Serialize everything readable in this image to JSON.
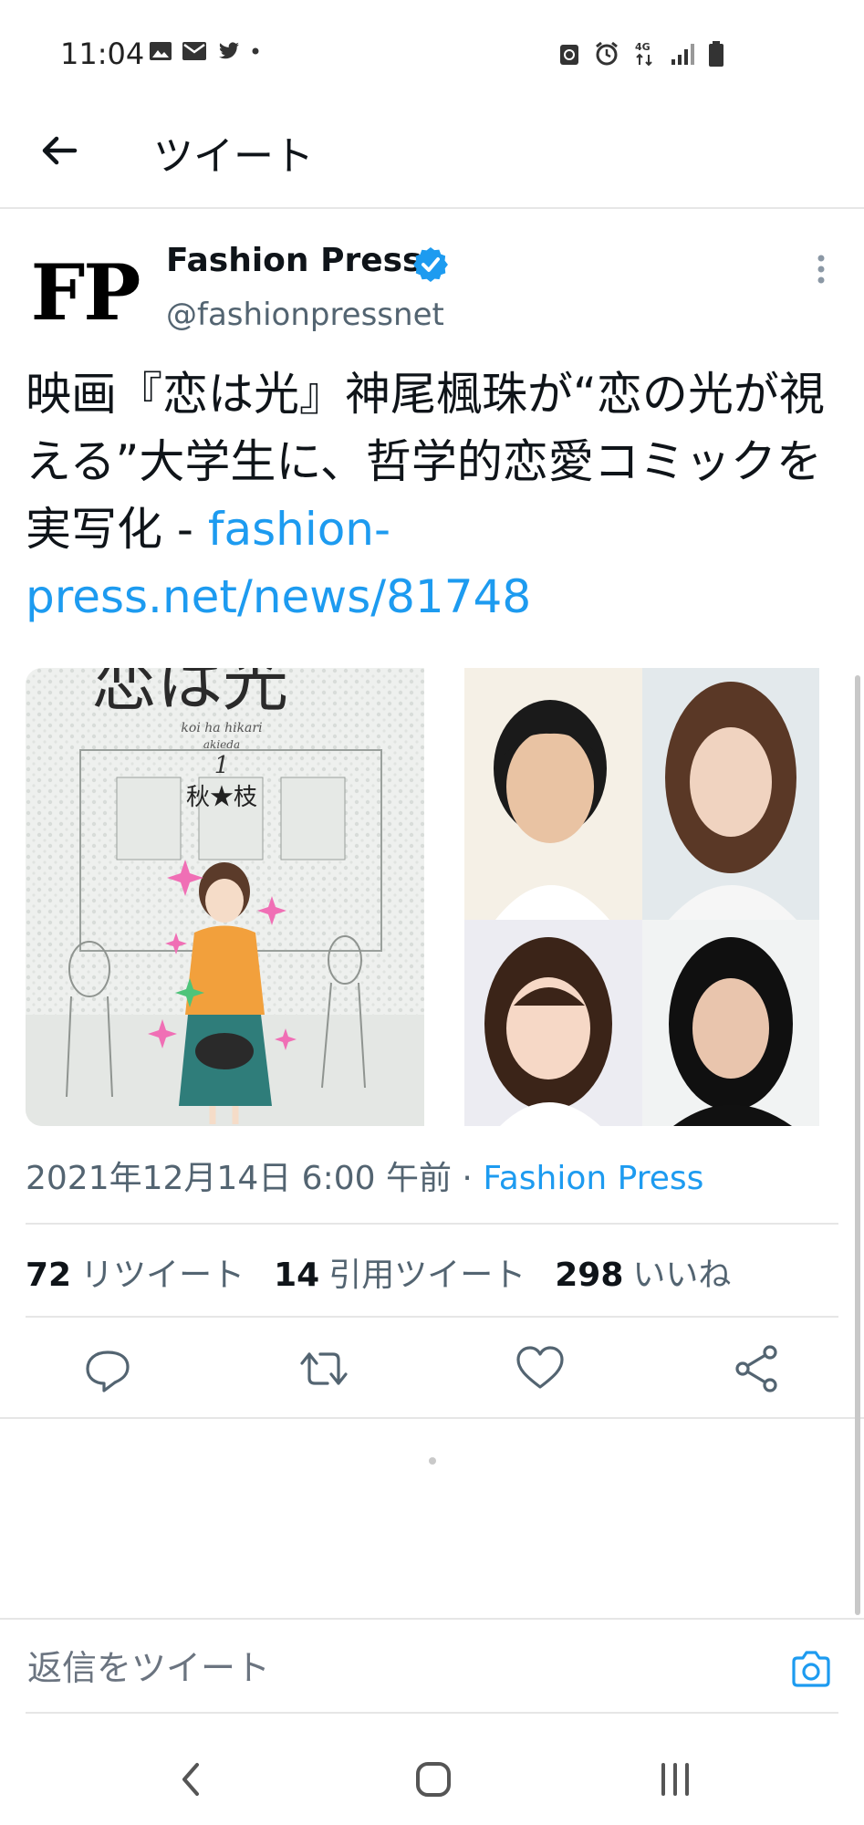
{
  "status_bar": {
    "time": "11:04"
  },
  "header": {
    "title": "ツイート"
  },
  "tweet": {
    "author_name": "Fashion Press",
    "author_handle": "@fashionpressnet",
    "avatar_text": "FP",
    "text_main": "映画『恋は光』神尾楓珠が“恋の光が視える”大学生に、哲学的恋愛コミックを実写化 - ",
    "text_link": "fashion-press.net/news/81748",
    "cover_title": "恋は光",
    "cover_romaji": "koi ha hikari",
    "cover_author_romaji": "akieda",
    "cover_volume": "1",
    "cover_author": "秋★枝",
    "timestamp": "2021年12月14日 6:00 午前",
    "separator": "·",
    "source": "Fashion Press",
    "stats": [
      {
        "count": "72",
        "label": "リツイート"
      },
      {
        "count": "14",
        "label": "引用ツイート"
      },
      {
        "count": "298",
        "label": "いいね"
      }
    ]
  },
  "reply": {
    "placeholder": "返信をツイート"
  },
  "colors": {
    "accent": "#1d9bf0",
    "muted": "#536471",
    "text": "#0f1419"
  },
  "icons": [
    "back-arrow-icon",
    "verified-badge-icon",
    "more-icon",
    "reply-icon",
    "retweet-icon",
    "like-icon",
    "share-icon",
    "camera-icon"
  ]
}
